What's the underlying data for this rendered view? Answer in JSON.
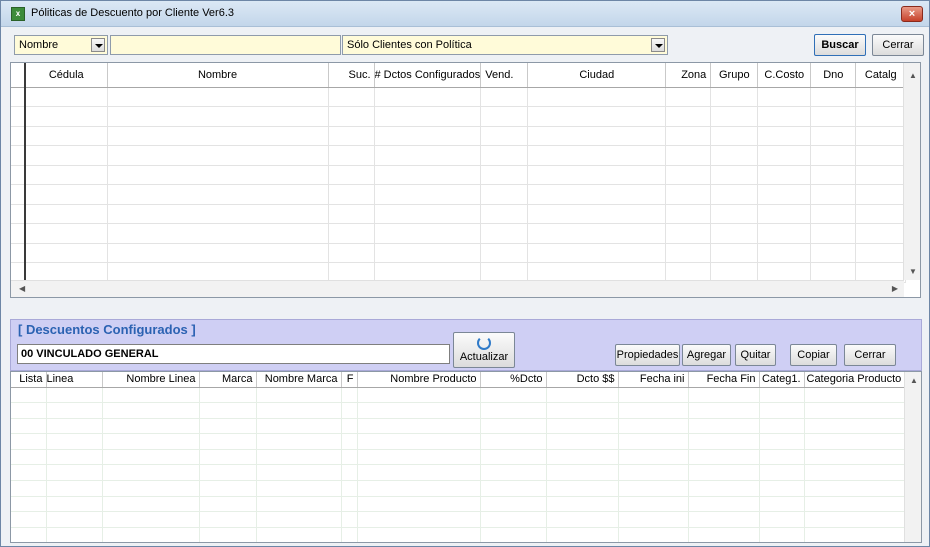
{
  "window": {
    "title": "Póliticas de Descuento por Cliente Ver6.3",
    "close_label": "×"
  },
  "filter": {
    "field_select": "Nombre",
    "search_value": "",
    "scope_select": "Sólo Clientes con Política",
    "search_button": "Buscar",
    "close_button": "Cerrar"
  },
  "clients_grid": {
    "columns": [
      "Cédula",
      "Nombre",
      "Suc.",
      "# Dctos Configurados",
      "Vend.",
      "Ciudad",
      "Zona",
      "Grupo",
      "C.Costo",
      "Dno",
      "Catalg"
    ],
    "rows": 10
  },
  "discounts_panel": {
    "title": "[ Descuentos Configurados ]",
    "profile": "00  VINCULADO GENERAL",
    "refresh_button": "Actualizar",
    "properties_button": "Propiedades",
    "add_button": "Agregar",
    "remove_button": "Quitar",
    "copy_button": "Copiar",
    "close_button": "Cerrar"
  },
  "discounts_grid": {
    "columns": [
      "Lista",
      "Linea",
      "Nombre Linea",
      "Marca",
      "Nombre Marca",
      "F",
      "Nombre Producto",
      "%Dcto",
      "Dcto $$",
      "Fecha ini",
      "Fecha Fin",
      "Categ1.",
      "Categoria Producto"
    ],
    "rows": 10
  },
  "colors": {
    "input_bg": "#fffbd9",
    "panel_bg": "#cfcff4",
    "panel_title": "#2b62b2"
  }
}
